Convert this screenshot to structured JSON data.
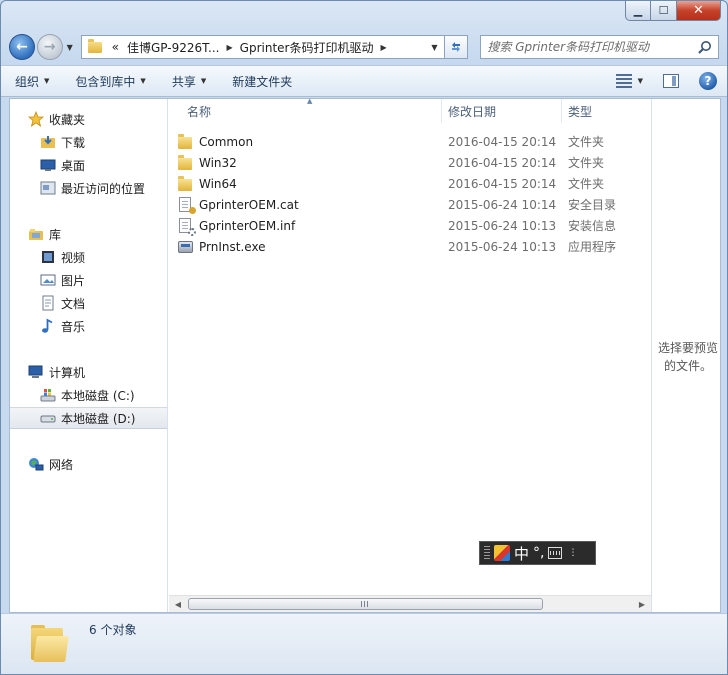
{
  "window": {
    "min_label": "▁",
    "max_label": "☐",
    "close_label": "✕"
  },
  "nav": {
    "back_label": "←",
    "forward_label": "→",
    "address": {
      "overflow": "«",
      "segments": [
        "佳博GP-9226T...",
        "Gprinter条码打印机驱动"
      ]
    },
    "search_placeholder": "搜索 Gprinter条码打印机驱动"
  },
  "toolbar": {
    "organize": "组织",
    "include_in_library": "包含到库中",
    "share": "共享",
    "new_folder": "新建文件夹",
    "help": "?"
  },
  "sidebar": {
    "favorites": {
      "label": "收藏夹",
      "items": [
        "下载",
        "桌面",
        "最近访问的位置"
      ]
    },
    "libraries": {
      "label": "库",
      "items": [
        "视频",
        "图片",
        "文档",
        "音乐"
      ]
    },
    "computer": {
      "label": "计算机",
      "items": [
        "本地磁盘 (C:)",
        "本地磁盘 (D:)"
      ]
    },
    "network": {
      "label": "网络"
    }
  },
  "columns": {
    "name": "名称",
    "date": "修改日期",
    "type": "类型"
  },
  "files": [
    {
      "name": "Common",
      "date": "2016-04-15 20:14",
      "type": "文件夹",
      "icon": "folder-icon"
    },
    {
      "name": "Win32",
      "date": "2016-04-15 20:14",
      "type": "文件夹",
      "icon": "folder-icon"
    },
    {
      "name": "Win64",
      "date": "2016-04-15 20:14",
      "type": "文件夹",
      "icon": "folder-icon"
    },
    {
      "name": "GprinterOEM.cat",
      "date": "2015-06-24 10:14",
      "type": "安全目录",
      "icon": "catalog-file-icon"
    },
    {
      "name": "GprinterOEM.inf",
      "date": "2015-06-24 10:13",
      "type": "安装信息",
      "icon": "setup-info-file-icon"
    },
    {
      "name": "PrnInst.exe",
      "date": "2015-06-24 10:13",
      "type": "应用程序",
      "icon": "application-icon"
    }
  ],
  "preview": {
    "text_line1": "选择要预览",
    "text_line2": "的文件。"
  },
  "ime": {
    "mode": "中",
    "punct": "°,"
  },
  "status": {
    "text": "6 个对象"
  }
}
